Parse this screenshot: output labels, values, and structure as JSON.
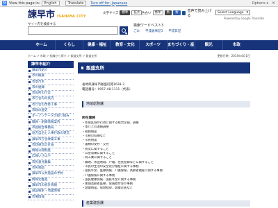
{
  "translate_bar": {
    "google": "Google",
    "view_page_in": "View this page in:",
    "language": "English",
    "translate_button": "Translate",
    "turn_off": "Turn off for: Japanese",
    "options": "Options ▾",
    "close": "×"
  },
  "header": {
    "logo_jp": "諫早市",
    "logo_en": "ISAHAYA CITY",
    "font_size_label": "文字サイズ",
    "font_chips": [
      "標準",
      "拡大"
    ],
    "color_label": "色合い",
    "color_chips": [
      "標準",
      "黒",
      "青"
    ],
    "read_aloud": "音声で読み上げる",
    "language_select": "Select Language",
    "powered_by": "Powered by Google Translate"
  },
  "search": {
    "label": "サイト内を検索する",
    "placeholder": ""
  },
  "keywords": {
    "title": "検索ワードベスト3",
    "items": [
      "ごみ",
      "平成歳事記3",
      "平成日記"
    ]
  },
  "nav": {
    "items": [
      "ホーム",
      "くらし",
      "健康・福祉",
      "教育・文化",
      "スポーツ",
      "まちづくり・産業",
      "観光",
      "市政"
    ]
  },
  "breadcrumb": "ホーム > 市政 > 組織から探す > 飯盛支所 > 飯盛支所",
  "sidebar": {
    "title": "諫早市紹介",
    "items": [
      "諫早市紹介",
      "市の概要",
      "市章市木",
      "市の組織",
      "市役所の庁舎",
      "市庁舎内の案内",
      "市庁舎の改修工事",
      "市政の歴史",
      "オープンデータの取り組み",
      "職員・組織情報案内",
      "市長総合事務局",
      "地方自治と人事行政の運営",
      "諫早市庁舎改築工事",
      "市政運営の計画",
      "情報公開制度",
      "広報いさはや",
      "市民意見募集",
      "市民相談",
      "諫早市公共施設の予約",
      "情報化推進",
      "諫早市の統計情報",
      "施設検索・地図情報",
      "市場情報"
    ]
  },
  "main": {
    "updated": "更新日時：2014年4月1日",
    "title": "飯盛支所",
    "address": "長崎県諫早市飯盛町開1628-3",
    "phone": "電話番号：0957-48-1111（代表）",
    "section1": "地域総務課",
    "duties_heading": "所在業務",
    "duties": [
      "・所管区域の行政に関する総合企画、調整",
      "・本庁との連絡調整",
      "・税務相談",
      "・市税の収納など",
      "・市民相談",
      "・書類の受付・交付",
      "・防災に関すること",
      "・公金収納に関すること",
      "・商工業に関すること",
      "・農地、水田地域、戸籍、住民登録などに関すること",
      "・市民の生活の安全及び福祉に関する事務",
      "・国民年金、医療保険、介護保険、高齢者福祉に関する事務",
      "・介護保険に関する事務",
      "・国民健康保険、国民年金に関する事務",
      "・後期高齢者医療、保険給付等の事務",
      "・健康相談、保健指導、健康診査など"
    ],
    "section2": "産業建設課"
  }
}
